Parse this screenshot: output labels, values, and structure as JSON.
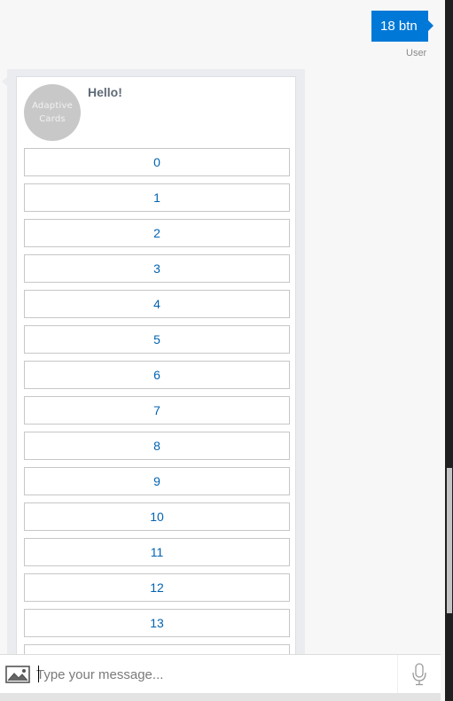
{
  "user_message": {
    "text": "18 btn",
    "sender": "User"
  },
  "bot_card": {
    "logo": {
      "line1": "Adaptive",
      "line2": "Cards"
    },
    "title": "Hello!",
    "buttons": [
      "0",
      "1",
      "2",
      "3",
      "4",
      "5",
      "6",
      "7",
      "8",
      "9",
      "10",
      "11",
      "12",
      "13"
    ]
  },
  "input": {
    "placeholder": "Type your message..."
  },
  "icons": {
    "upload": "image-icon",
    "mic": "microphone-icon"
  },
  "colors": {
    "accent": "#0078d7",
    "button_text": "#0063b1"
  }
}
